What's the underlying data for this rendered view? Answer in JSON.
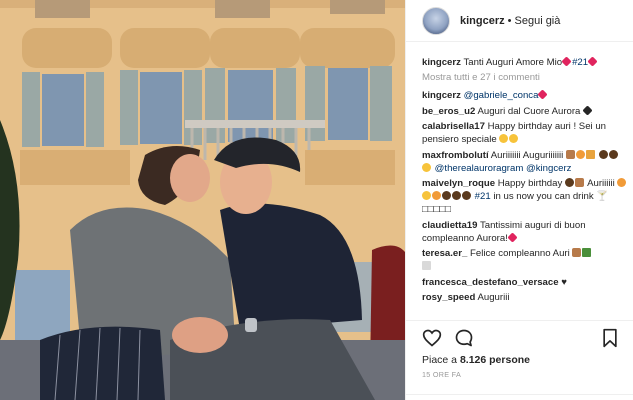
{
  "post": {
    "username": "kingcerz",
    "separator": "•",
    "follow_status": "Segui già",
    "caption_text": "Tanti Auguri Amore Mio",
    "caption_tag": "#21",
    "show_all_comments": "Mostra tutti e 27 i commenti"
  },
  "comments": [
    {
      "user": "kingcerz",
      "text": "",
      "mention": "@gabriele_conca"
    },
    {
      "user": "be_eros_u2",
      "text": "Auguri dal Cuore Aurora"
    },
    {
      "user": "calabrisella17",
      "text": "Happy birthday auri ! Sei un pensiero speciale"
    },
    {
      "user": "maxfrombolutí",
      "text": "Auriiiiiii Auguriiiiiii",
      "mentions": "@therealauroragram @kingcerz"
    },
    {
      "user": "maivelyn_roque",
      "text": "Happy birthday",
      "text2": "Auriiiiii",
      "tag": "#21",
      "text3": "in us now you can drink",
      "boxes": "🍸 □□□□□"
    },
    {
      "user": "claudietta19",
      "text": "Tantissimi auguri di buon compleanno Aurora!"
    },
    {
      "user": "teresa.er_",
      "text": "Felice compleanno Auri"
    },
    {
      "user": "francesca_destefano_versace",
      "text": "♥"
    },
    {
      "user": "rosy_speed",
      "text": "Auguriii"
    }
  ],
  "stats": {
    "likes_prefix": "Piace a",
    "likes_count": "8.126 persone",
    "time": "15 ORE FA"
  },
  "icons": [
    "heart-icon",
    "comment-icon",
    "bookmark-icon"
  ],
  "colors": {
    "link": "#003569",
    "muted": "#999999",
    "text": "#262626"
  }
}
